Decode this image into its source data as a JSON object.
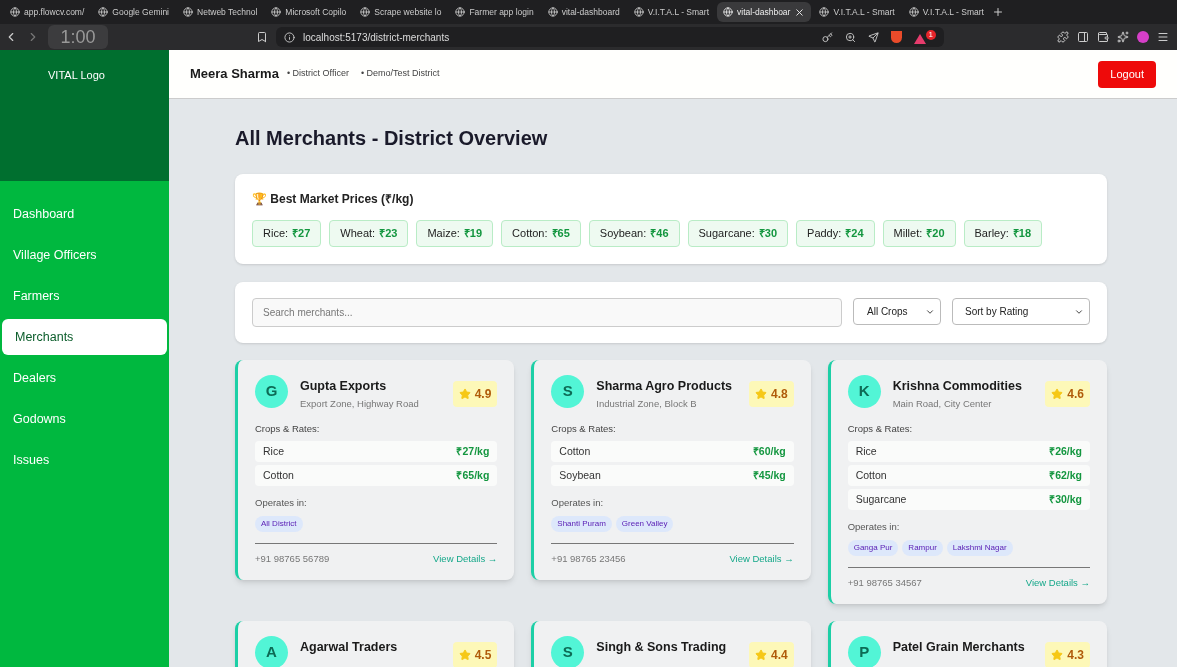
{
  "browser": {
    "tabs": [
      {
        "label": "app.flowcv.com/",
        "selected": false
      },
      {
        "label": "Google Gemini",
        "selected": false
      },
      {
        "label": "Netweb Technol",
        "selected": false
      },
      {
        "label": "Microsoft Copilo",
        "selected": false
      },
      {
        "label": "Scrape website lo",
        "selected": false
      },
      {
        "label": "Farmer app login",
        "selected": false
      },
      {
        "label": "vital-dashboard",
        "selected": false
      },
      {
        "label": "V.I.T.A.L - Smart",
        "selected": false
      },
      {
        "label": "vital-dashboar",
        "selected": true
      },
      {
        "label": "V.I.T.A.L - Smart",
        "selected": false
      },
      {
        "label": "V.I.T.A.L - Smart",
        "selected": false
      }
    ],
    "url": "localhost:5173/district-merchants",
    "timer": "1:00",
    "badge": "1"
  },
  "sidebar": {
    "logo_alt": "VITAL Logo",
    "items": [
      {
        "label": "Dashboard",
        "selected": false
      },
      {
        "label": "Village Officers",
        "selected": false
      },
      {
        "label": "Farmers",
        "selected": false
      },
      {
        "label": "Merchants",
        "selected": true
      },
      {
        "label": "Dealers",
        "selected": false
      },
      {
        "label": "Godowns",
        "selected": false
      },
      {
        "label": "Issues",
        "selected": false
      }
    ]
  },
  "header": {
    "name": "Meera Sharma",
    "role": "• District Officer",
    "district": "• Demo/Test District",
    "logout": "Logout"
  },
  "title": "All Merchants - District Overview",
  "best_prices": {
    "icon": "🏆",
    "title": "Best Market Prices (₹/kg)",
    "items": [
      {
        "crop": "Rice:",
        "price": "₹27"
      },
      {
        "crop": "Wheat:",
        "price": "₹23"
      },
      {
        "crop": "Maize:",
        "price": "₹19"
      },
      {
        "crop": "Cotton:",
        "price": "₹65"
      },
      {
        "crop": "Soybean:",
        "price": "₹46"
      },
      {
        "crop": "Sugarcane:",
        "price": "₹30"
      },
      {
        "crop": "Paddy:",
        "price": "₹24"
      },
      {
        "crop": "Millet:",
        "price": "₹20"
      },
      {
        "crop": "Barley:",
        "price": "₹18"
      }
    ]
  },
  "filters": {
    "search_placeholder": "Search merchants...",
    "crop_select": "All Crops",
    "sort_select": "Sort by Rating"
  },
  "merchants": [
    {
      "initial": "G",
      "name": "Gupta Exports",
      "address": "Export Zone, Highway Road",
      "rating": "4.9",
      "rates_label": "Crops & Rates:",
      "rates": [
        {
          "crop": "Rice",
          "price": "₹27/kg"
        },
        {
          "crop": "Cotton",
          "price": "₹65/kg"
        }
      ],
      "operates_label": "Operates in:",
      "areas": [
        "All District"
      ],
      "phone": "+91 98765 56789",
      "link": "View Details →"
    },
    {
      "initial": "S",
      "name": "Sharma Agro Products",
      "address": "Industrial Zone, Block B",
      "rating": "4.8",
      "rates_label": "Crops & Rates:",
      "rates": [
        {
          "crop": "Cotton",
          "price": "₹60/kg"
        },
        {
          "crop": "Soybean",
          "price": "₹45/kg"
        }
      ],
      "operates_label": "Operates in:",
      "areas": [
        "Shanti Puram",
        "Green Valley"
      ],
      "phone": "+91 98765 23456",
      "link": "View Details →"
    },
    {
      "initial": "K",
      "name": "Krishna Commodities",
      "address": "Main Road, City Center",
      "rating": "4.6",
      "rates_label": "Crops & Rates:",
      "rates": [
        {
          "crop": "Rice",
          "price": "₹26/kg"
        },
        {
          "crop": "Cotton",
          "price": "₹62/kg"
        },
        {
          "crop": "Sugarcane",
          "price": "₹30/kg"
        }
      ],
      "operates_label": "Operates in:",
      "areas": [
        "Ganga Pur",
        "Rampur",
        "Lakshmi Nagar"
      ],
      "phone": "+91 98765 34567",
      "link": "View Details →"
    },
    {
      "initial": "A",
      "name": "Agarwal Traders",
      "rating": "4.5"
    },
    {
      "initial": "S",
      "name": "Singh & Sons Trading",
      "rating": "4.4"
    },
    {
      "initial": "P",
      "name": "Patel Grain Merchants",
      "rating": "4.3"
    }
  ]
}
